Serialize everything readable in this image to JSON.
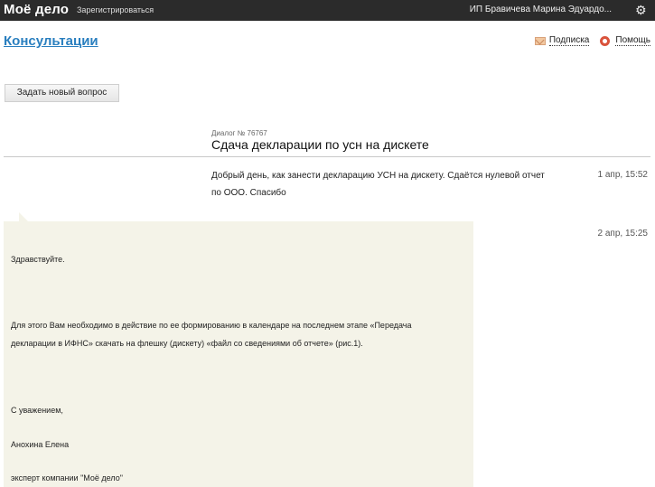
{
  "header": {
    "logo": "Моё дело",
    "register_label": "Зарегистрироваться",
    "user_name": "ИП Бравичева Марина Эдуардо...",
    "settings_icon": "gear-icon"
  },
  "page": {
    "title": "Консультации",
    "links": {
      "subscribe": "Подписка",
      "help": "Помощь"
    },
    "ask_button": "Задать новый вопрос"
  },
  "dialog": {
    "number": "Диалог № 76767",
    "title": "Сдача декларации по усн на дискете",
    "question": {
      "text": "Добрый день, как занести декларацию УСН на дискету. Сдаётся нулевой отчет по ООО. Спасибо",
      "time": "1 апр, 15:52"
    },
    "answer": {
      "time": "2 апр, 15:25",
      "greeting": "Здравствуйте.",
      "body_line1": "Для  этого Вам необходимо  в действие по ее формированию в календаре на  последнем этапе «Передача",
      "body_line2": "декларации в ИФНС» скачать на  флешку (дискету)  «файл со сведениями об отчете» (рис.1).",
      "regards": "С уважением,",
      "author": "Анохина Елена",
      "role": "эксперт компании \"Моё дело\""
    }
  },
  "colors": {
    "topbar": "#2b2b2b",
    "title_link": "#2a7fbf",
    "answer_bg": "#f4f3e8"
  }
}
